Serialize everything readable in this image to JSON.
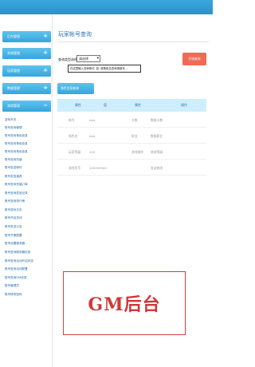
{
  "sidebar": {
    "groups": [
      {
        "label": "后台管理",
        "sign": "+"
      },
      {
        "label": "系统管理",
        "sign": "+"
      },
      {
        "label": "玩家管理",
        "sign": "+"
      },
      {
        "label": "数据管理",
        "sign": "+"
      },
      {
        "label": "游戏管理",
        "sign": "−"
      }
    ],
    "items": [
      "游戏开关",
      "账号查询管理",
      "账号查询角色信息",
      "账号查询角色信息",
      "账号查询角色信息",
      "账号查询充值",
      "账号发送邮件",
      "账号发放道具",
      "账号查询充值订单",
      "账号查询发放记录",
      "账号查询排行榜",
      "账号游戏日志",
      "账号开启关闭",
      "账号发送公告",
      "账号开服配置",
      "账号设置服务器",
      "账号查询服务器信息",
      "账号查询活动开启状态",
      "账号查询活动配置",
      "账号查询GM信息",
      "账号管理员",
      "账号修改密码"
    ]
  },
  "main": {
    "title": "玩家帐号查询",
    "form_label": "查询类型选择:",
    "select_value": "请选择",
    "query_value": "在这里输入查询条件, 如: 按角色名查询请填写...",
    "query_button": "开始查询"
  },
  "info_bar": "角色信息查询",
  "table": {
    "headers": [
      "属性",
      "值",
      "属性",
      "操作"
    ],
    "rows": [
      [
        "帐号",
        "test",
        "卡数",
        "数据卡数"
      ],
      [
        "角色名",
        "test",
        "职业",
        "数据职业"
      ],
      [
        "玩家等级",
        "100",
        "游戏操作",
        "修改等级"
      ],
      [
        "游戏货币",
        "100000000",
        "",
        "发送修改"
      ]
    ]
  },
  "watermark": "GM后台"
}
